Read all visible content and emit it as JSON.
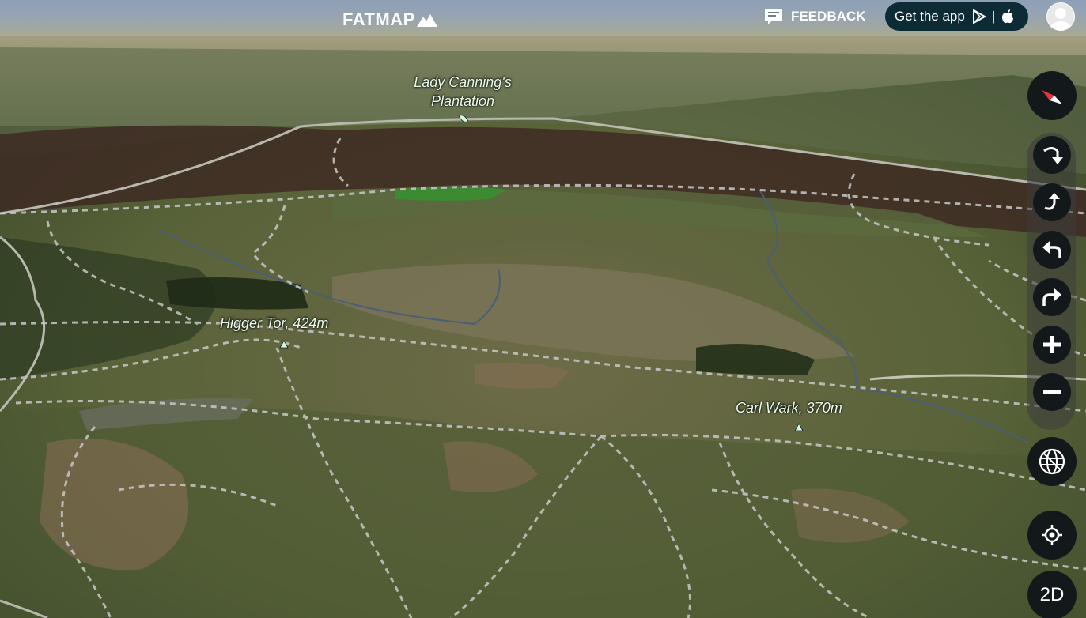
{
  "header": {
    "logo_text": "FATMAP",
    "feedback_label": "FEEDBACK",
    "get_app_label": "Get the app",
    "get_app_separator": "|"
  },
  "map_labels": [
    {
      "name": "lady-cannings-plantation",
      "line1": "Lady Canning's",
      "line2": "Plantation"
    },
    {
      "name": "higger-tor",
      "line1": "Higger Tor, 424m",
      "line2": ""
    },
    {
      "name": "carl-wark",
      "line1": "Carl Wark, 370m",
      "line2": ""
    }
  ],
  "controls": {
    "compass_icon": "compass-icon",
    "rotate_down_icon": "tilt-down-icon",
    "rotate_up_icon": "tilt-up-icon",
    "rotate_left_icon": "rotate-left-icon",
    "rotate_right_icon": "rotate-right-icon",
    "zoom_in_icon": "plus-icon",
    "zoom_out_icon": "minus-icon",
    "layers_icon": "globe-icon",
    "locate_icon": "locate-icon",
    "mode_label": "2D"
  },
  "colors": {
    "button_bg": "#13191b",
    "get_app_bg": "#0c2b34",
    "compass_red": "#e8323c",
    "label_text": "#eafbe9"
  }
}
